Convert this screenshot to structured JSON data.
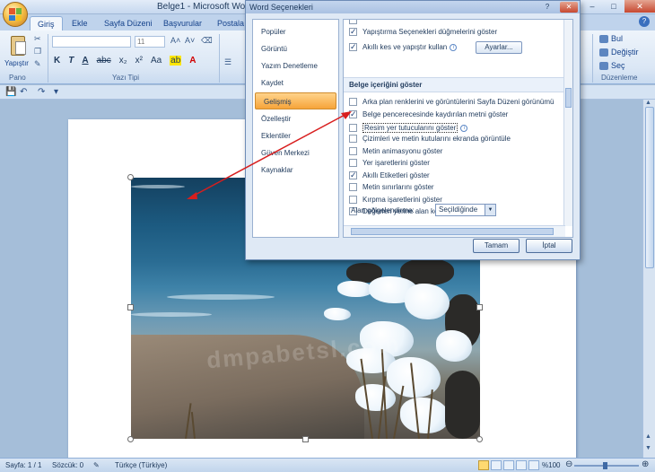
{
  "window": {
    "title": "Belge1 - Microsoft Word",
    "help_glyph": "?",
    "minimize": "–",
    "maximize": "□",
    "close": "✕"
  },
  "ribbon": {
    "tabs": [
      "Giriş",
      "Ekle",
      "Sayfa Düzeni",
      "Başvurular",
      "Postala"
    ],
    "active_tab": "Giriş",
    "paste_label": "Yapıştır",
    "groups": {
      "clipboard": "Pano",
      "font": "Yazı Tipi",
      "editing": "Düzenleme"
    },
    "font_size": "11",
    "format_buttons": [
      "K",
      "T",
      "A",
      "abc",
      "x₂",
      "x²",
      "Aa",
      "ab",
      "A"
    ],
    "editing_buttons": [
      "Bul",
      "Değiştir",
      "Seç"
    ]
  },
  "dialog": {
    "title": "Word Seçenekleri",
    "help_glyph": "?",
    "close_glyph": "✕",
    "nav": [
      "Popüler",
      "Görüntü",
      "Yazım Denetleme",
      "Kaydet",
      "Gelişmiş",
      "Özelleştir",
      "Eklentiler",
      "Güven Merkezi",
      "Kaynaklar"
    ],
    "selected_nav": "Gelişmiş",
    "top_options": [
      {
        "label": "Yapıştırma Seçenekleri düğmelerini göster",
        "checked": true
      },
      {
        "label": "Akıllı kes ve yapıştır kullan",
        "checked": true
      }
    ],
    "settings_button": "Ayarlar...",
    "section_header": "Belge içeriğini göster",
    "options": [
      {
        "label": "Arka plan renklerini ve görüntülerini Sayfa Düzeni görünümü",
        "checked": false
      },
      {
        "label": "Belge pencerecesinde kaydırılan metni göster",
        "checked": true
      },
      {
        "label": "Resim yer tutucularını göster",
        "checked": false
      },
      {
        "label": "Çizimleri ve metin kutularını ekranda görüntüle",
        "checked": false
      },
      {
        "label": "Metin animasyonu göster",
        "checked": false
      },
      {
        "label": "Yer işaretlerini göster",
        "checked": false
      },
      {
        "label": "Akıllı Etiketleri göster",
        "checked": true
      },
      {
        "label": "Metin sınırlarını göster",
        "checked": false
      },
      {
        "label": "Kırpma işaretlerini göster",
        "checked": false
      },
      {
        "label": "Değerleri yerine alan kodlarını göster",
        "checked": false
      }
    ],
    "shading_label": "Alan gölgelendirme:",
    "shading_value": "Seçildiğinde",
    "ok_button": "Tamam",
    "cancel_button": "İptal"
  },
  "document": {
    "watermark": "dmpabetsl.com"
  },
  "status": {
    "page": "Sayfa: 1 / 1",
    "words": "Sözcük: 0",
    "language": "Türkçe (Türkiye)",
    "zoom": "%100"
  },
  "colors": {
    "accent": "#15428b",
    "arrow": "#d81e1e",
    "selected_nav": "#f6a43a"
  }
}
